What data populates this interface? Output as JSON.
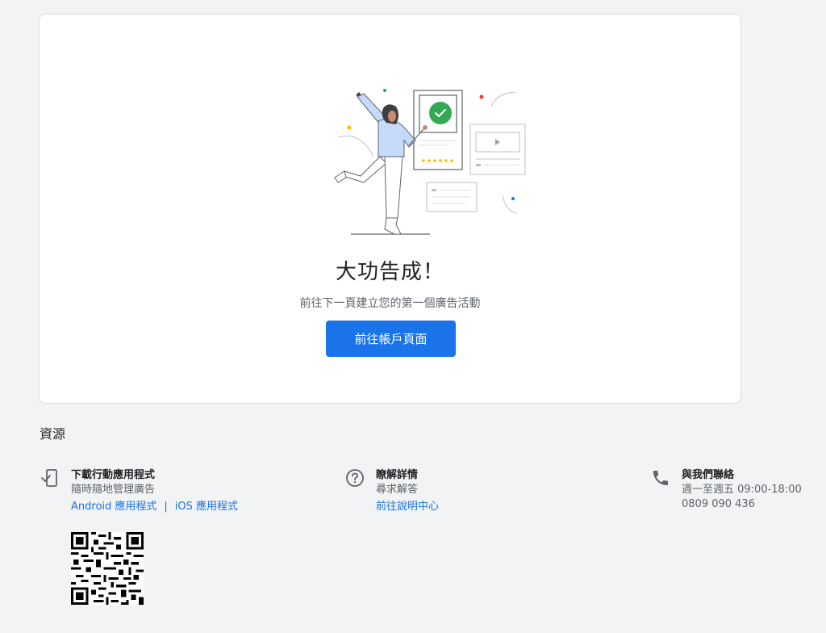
{
  "card": {
    "title": "大功告成！",
    "subtitle": "前往下一頁建立您的第一個廣告活動",
    "cta_label": "前往帳戶頁面"
  },
  "resources": {
    "heading": "資源",
    "app": {
      "icon": "mobile-download-icon",
      "title": "下載行動應用程式",
      "desc": "隨時隨地管理廣告",
      "android_link": "Android 應用程式",
      "separator": "|",
      "ios_link": "iOS 應用程式"
    },
    "help": {
      "icon": "help-circle-icon",
      "title": "瞭解詳情",
      "desc": "尋求解答",
      "link": "前往說明中心"
    },
    "contact": {
      "icon": "phone-icon",
      "title": "與我們聯絡",
      "hours": "週一至週五 09:00-18:00",
      "phone": "0809 090 436"
    }
  },
  "colors": {
    "primary": "#1a73e8",
    "success": "#34a853",
    "accent_yellow": "#fbbc04",
    "accent_red": "#ea4335"
  }
}
